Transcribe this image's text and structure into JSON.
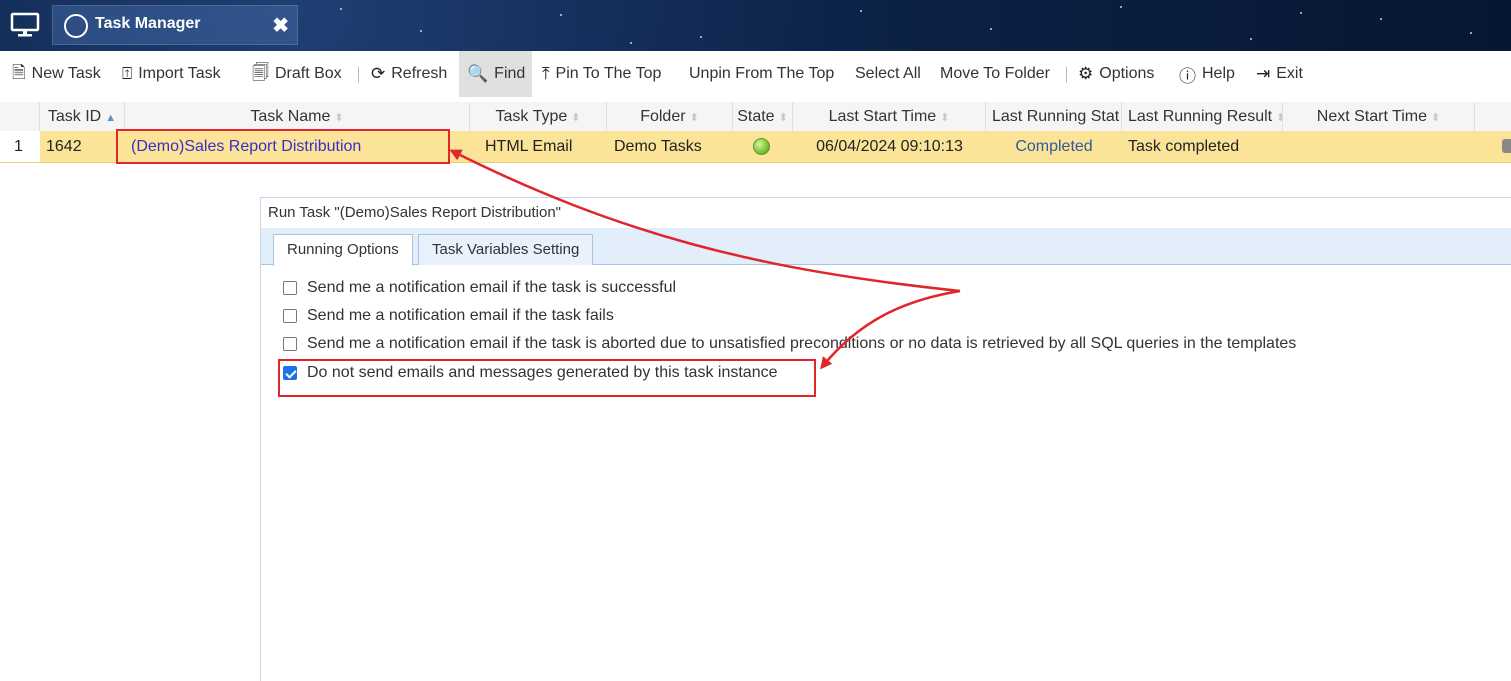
{
  "titlebar": {
    "app_icon": "monitor-icon",
    "tab_title": "Task Manager",
    "tab_icon": "task-manager-icon",
    "close_icon": "close-icon"
  },
  "toolbar": {
    "new_task": "New Task",
    "import_task": "Import Task",
    "draft_box": "Draft Box",
    "refresh": "Refresh",
    "find": "Find",
    "pin_top": "Pin To The Top",
    "unpin_top": "Unpin From The Top",
    "select_all": "Select All",
    "move_to_folder": "Move To Folder",
    "options": "Options",
    "help": "Help",
    "exit": "Exit"
  },
  "grid": {
    "columns": [
      "Task ID",
      "Task Name",
      "Task Type",
      "Folder",
      "State",
      "Last Start Time",
      "Last Running Stat",
      "Last Running Result",
      "Next Start Time"
    ],
    "row": {
      "num": "1",
      "task_id": "1642",
      "task_name": "(Demo)Sales Report Distribution",
      "task_type": "HTML Email",
      "folder": "Demo Tasks",
      "state_icon": "green-status-icon",
      "last_start_time": "06/04/2024 09:10:13",
      "last_running_status": "Completed",
      "last_running_result": "Task completed",
      "next_start_time": ""
    }
  },
  "dialog": {
    "title": "Run Task \"(Demo)Sales Report Distribution\"",
    "tabs": [
      "Running Options",
      "Task Variables Setting"
    ],
    "options": [
      {
        "label": "Send me a notification email if the task is successful",
        "checked": false
      },
      {
        "label": "Send me a notification email if the task fails",
        "checked": false
      },
      {
        "label": "Send me a notification email if the task is aborted due to unsatisfied preconditions or no data is retrieved by all SQL queries in the templates",
        "checked": false
      },
      {
        "label": "Do not send emails and messages generated by this task instance",
        "checked": true
      }
    ]
  },
  "colors": {
    "titlebar_bg": "#0d2248",
    "row_highlight": "#fbe498",
    "link": "#3a2ec9",
    "annotation_red": "#e0252b",
    "checkbox_blue": "#1a73e8"
  }
}
